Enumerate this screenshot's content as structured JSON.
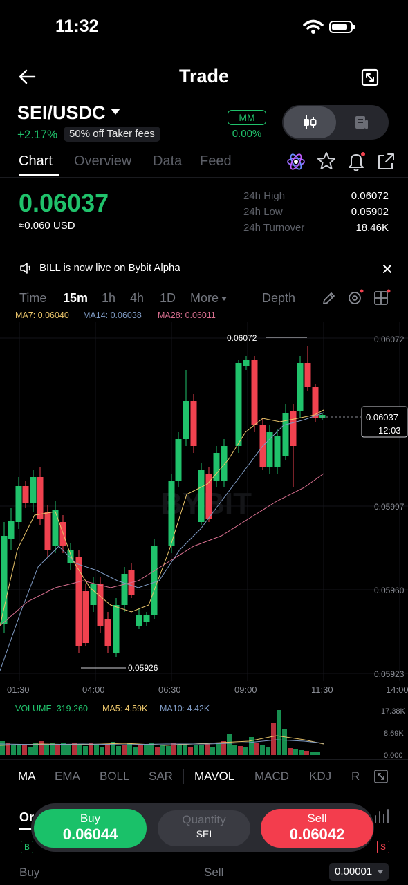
{
  "status": {
    "time": "11:32"
  },
  "header": {
    "title": "Trade"
  },
  "pair": {
    "symbol": "SEI/USDC",
    "change": "+2.17%",
    "fee_badge": "50% off Taker fees",
    "mm_label": "MM",
    "mm_value": "0.00%"
  },
  "tabs": [
    "Chart",
    "Overview",
    "Data",
    "Feed"
  ],
  "ticker": {
    "last_price": "0.06037",
    "usd_equiv": "≈0.060 USD",
    "high_label": "24h High",
    "high_value": "0.06072",
    "low_label": "24h Low",
    "low_value": "0.05902",
    "turnover_label": "24h Turnover",
    "turnover_value": "18.46K"
  },
  "notice": {
    "text": "BILL is now live on Bybit Alpha"
  },
  "timeframes": [
    "Time",
    "15m",
    "1h",
    "4h",
    "1D",
    "More",
    "Depth"
  ],
  "ma": {
    "ma7": "MA7: 0.06040",
    "ma14": "MA14: 0.06038",
    "ma28": "MA28: 0.06011"
  },
  "chart": {
    "right_ticks": [
      "0.06072",
      "0.05997",
      "0.05960",
      "0.05923"
    ],
    "time_ticks": [
      "01:30",
      "04:00",
      "06:30",
      "09:00",
      "11:30",
      "14:00"
    ],
    "high_marker": "0.06072",
    "low_marker": "0.05926",
    "price_tag": "0.06037",
    "countdown": "12:03",
    "watermark": "BYBIT",
    "colors": {
      "up": "#20c26b",
      "down": "#f0424f",
      "ma7": "#e9c46a",
      "ma14": "#7f9bc4",
      "ma28": "#d86f8f"
    }
  },
  "volume": {
    "label": "VOLUME: 319.260",
    "ma5": "MA5: 4.59K",
    "ma10": "MA10: 4.42K",
    "ticks": [
      "17.38K",
      "8.69K",
      "0.000"
    ]
  },
  "indicators": [
    "MA",
    "EMA",
    "BOLL",
    "SAR",
    "MAVOL",
    "MACD",
    "KDJ",
    "R"
  ],
  "order": {
    "buy_label": "Buy",
    "buy_price": "0.06044",
    "qty_label": "Quantity",
    "qty_unit": "SEI",
    "sell_label": "Sell",
    "sell_price": "0.06042"
  },
  "bottom": {
    "buy": "Buy",
    "sell": "Sell",
    "tick_size": "0.00001"
  }
}
